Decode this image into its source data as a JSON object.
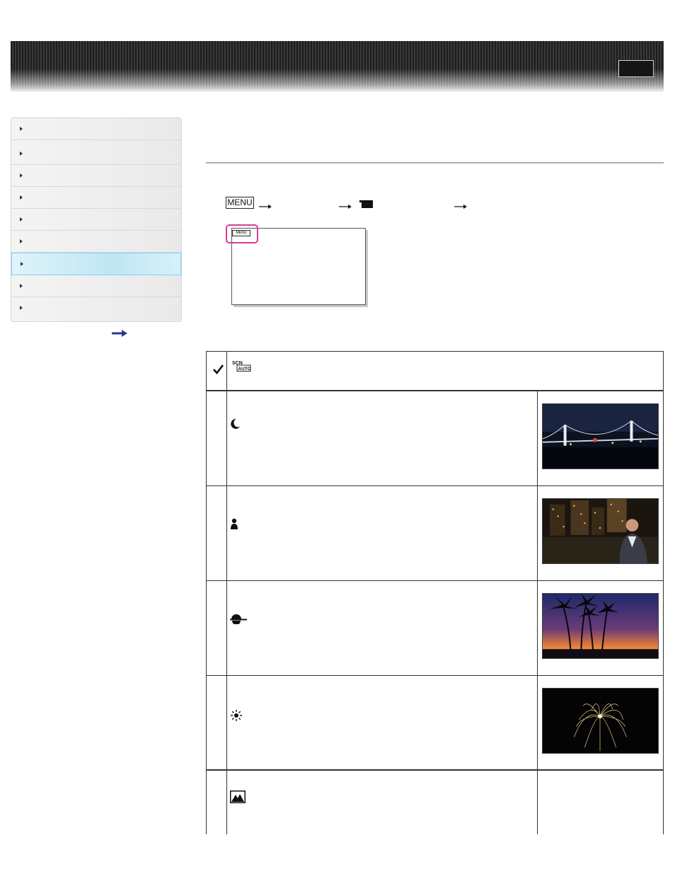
{
  "header": {
    "banner_button_label": ""
  },
  "sidebar": {
    "items": [
      {
        "label": "",
        "active": false
      },
      {
        "label": "",
        "active": false
      },
      {
        "label": "",
        "active": false
      },
      {
        "label": "",
        "active": false
      },
      {
        "label": "",
        "active": false
      },
      {
        "label": "",
        "active": false
      },
      {
        "label": "",
        "active": true
      },
      {
        "label": "",
        "active": false
      },
      {
        "label": "",
        "active": false
      }
    ]
  },
  "main": {
    "menu_path": {
      "menu_label": "MENU"
    },
    "screen_menu_label": "MENU",
    "scene_table": {
      "rows": [
        {
          "icon": "scn-auto-icon",
          "icon_text": [
            "SCN",
            "AUTO"
          ],
          "selected": true,
          "thumbnail": null
        },
        {
          "icon": "night-scene-icon",
          "selected": false,
          "thumbnail": "night-bridge"
        },
        {
          "icon": "night-portrait-icon",
          "selected": false,
          "thumbnail": "night-portrait"
        },
        {
          "icon": "sunrise-sunset-icon",
          "selected": false,
          "thumbnail": "palm-sunset"
        },
        {
          "icon": "fireworks-icon",
          "selected": false,
          "thumbnail": "fireworks"
        },
        {
          "icon": "landscape-icon",
          "selected": false,
          "thumbnail": null
        }
      ]
    }
  },
  "colors": {
    "active_sidebar": "#bfe6f2",
    "highlight_ring": "#d63c92",
    "more_arrow": "#2b3a8f"
  }
}
